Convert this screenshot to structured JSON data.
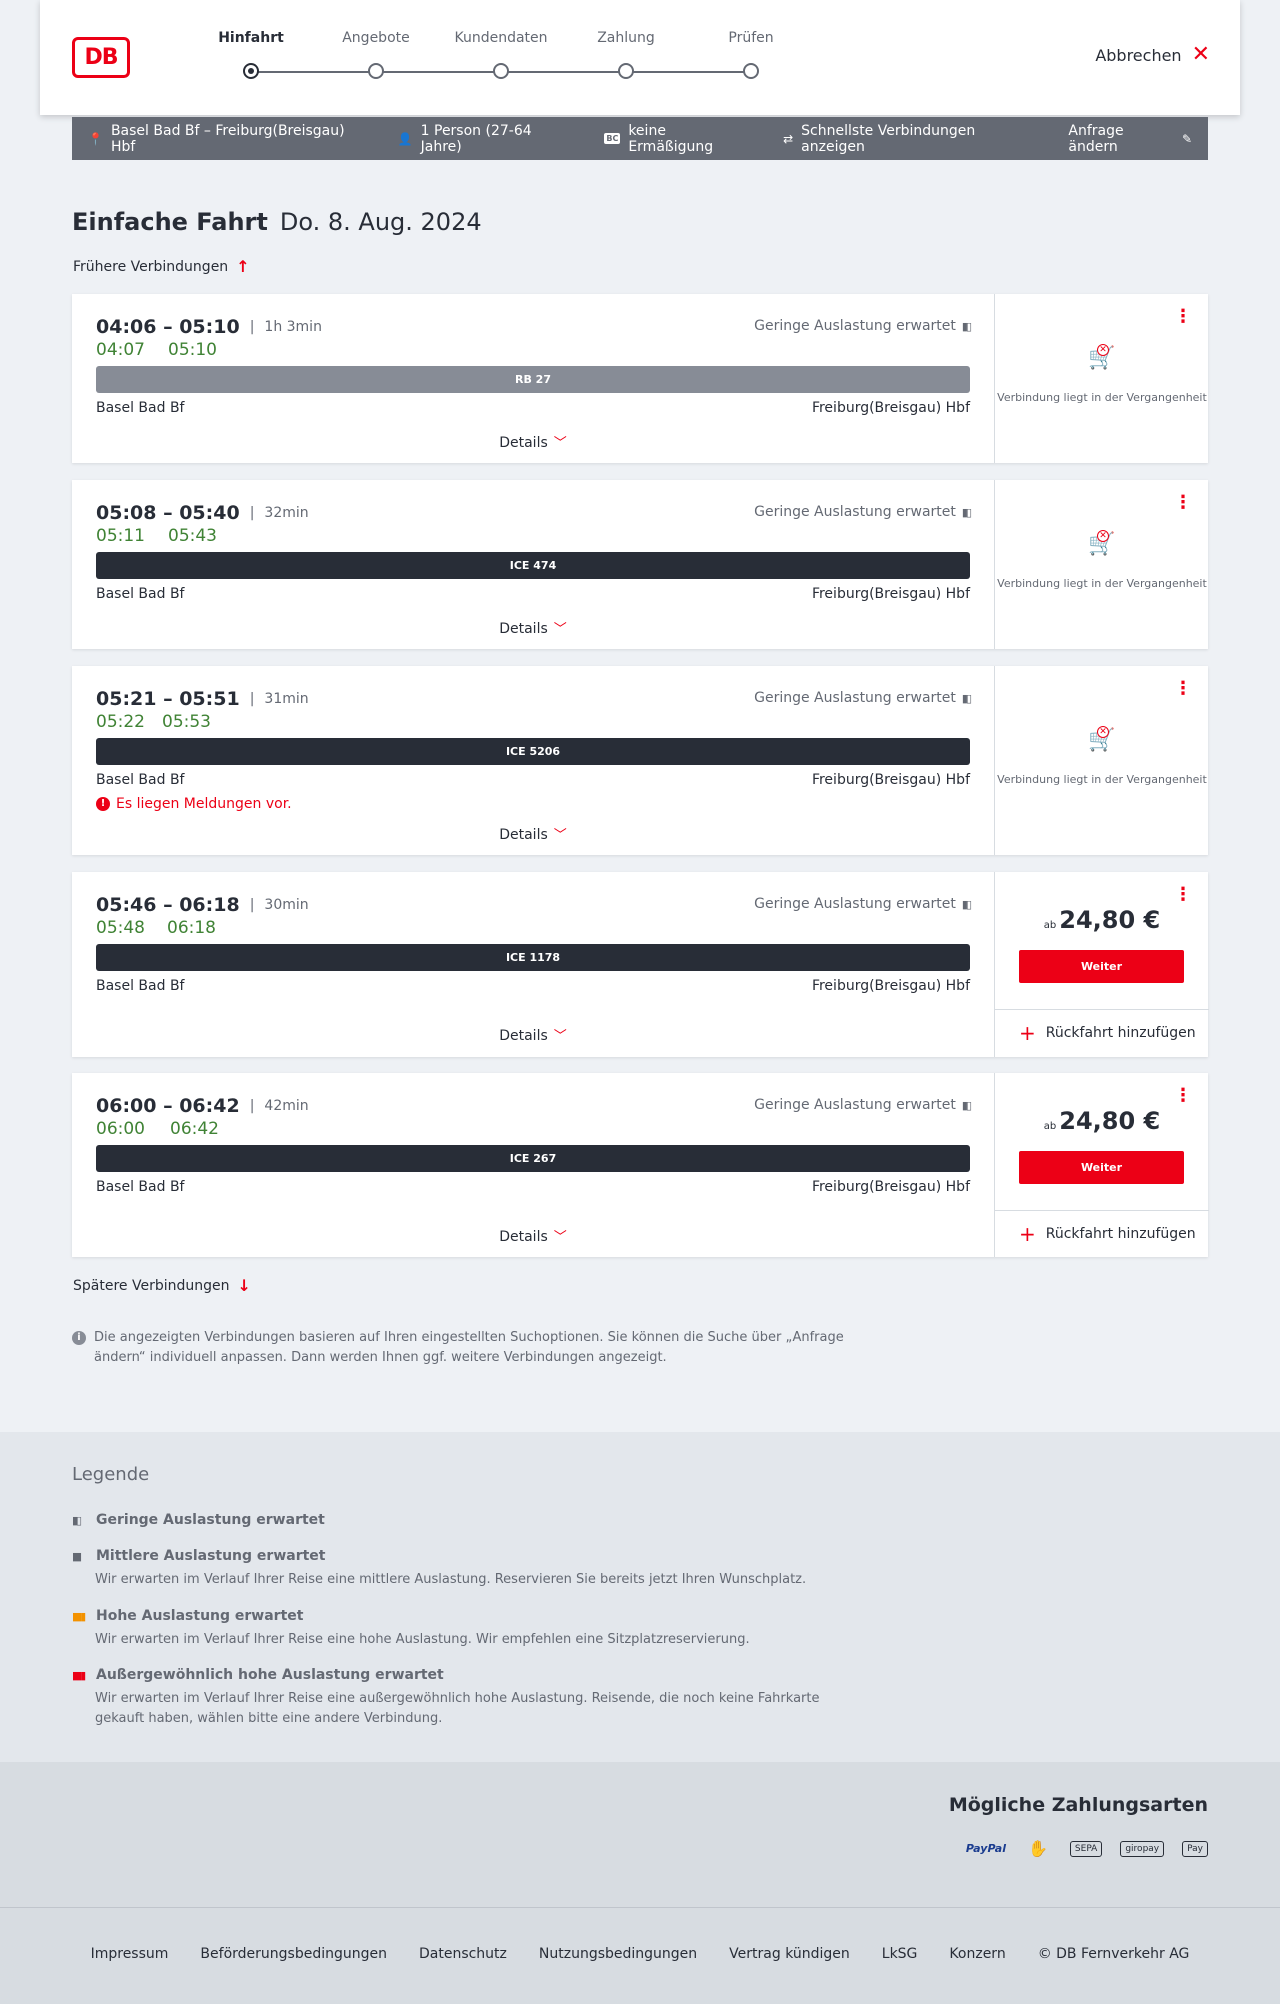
{
  "header": {
    "logo": "DB",
    "steps": [
      "Hinfahrt",
      "Angebote",
      "Kundendaten",
      "Zahlung",
      "Prüfen"
    ],
    "cancel_label": "Abbrechen"
  },
  "summary": {
    "route": "Basel Bad Bf – Freiburg(Breisgau) Hbf",
    "travellers": "1 Person (27-64 Jahre)",
    "bc_badge": "BC",
    "discount": "keine Ermäßigung",
    "fastest": "Schnellste Verbindungen anzeigen",
    "change": "Anfrage ändern"
  },
  "page": {
    "trip_type": "Einfache Fahrt",
    "date": "Do. 8. Aug. 2024",
    "earlier": "Frühere Verbindungen",
    "later": "Spätere Verbindungen",
    "details_label": "Details",
    "past_text": "Verbindung liegt in der Vergangenheit",
    "price_prefix": "ab",
    "continue_label": "Weiter",
    "return_label": "Rückfahrt hinzufügen",
    "info_text": "Die angezeigten Verbindungen basieren auf Ihren eingestellten Suchoptionen. Sie können die Suche über „Anfrage ändern“ individuell anpassen. Dann werden Ihnen ggf. weitere Verbindungen angezeigt."
  },
  "connections": [
    {
      "plan": "04:06 – 05:10",
      "duration": "1h 3min",
      "rt_dep": "04:07",
      "rt_arr": "05:10",
      "load": "Geringe Auslastung erwartet",
      "train": "RB 27",
      "from": "Basel Bad Bf",
      "to": "Freiburg(Breisgau) Hbf",
      "message": "",
      "price": "",
      "past": true
    },
    {
      "plan": "05:08 – 05:40",
      "duration": "32min",
      "rt_dep": "05:11",
      "rt_arr": "05:43",
      "load": "Geringe Auslastung erwartet",
      "train": "ICE 474",
      "from": "Basel Bad Bf",
      "to": "Freiburg(Breisgau) Hbf",
      "message": "",
      "price": "",
      "past": true
    },
    {
      "plan": "05:21 – 05:51",
      "duration": "31min",
      "rt_dep": "05:22",
      "rt_arr": "05:53",
      "load": "Geringe Auslastung erwartet",
      "train": "ICE 5206",
      "from": "Basel Bad Bf",
      "to": "Freiburg(Breisgau) Hbf",
      "message": "Es liegen Meldungen vor.",
      "price": "",
      "past": true
    },
    {
      "plan": "05:46 – 06:18",
      "duration": "30min",
      "rt_dep": "05:48",
      "rt_arr": "06:18",
      "load": "Geringe Auslastung erwartet",
      "train": "ICE 1178",
      "from": "Basel Bad Bf",
      "to": "Freiburg(Breisgau) Hbf",
      "message": "",
      "price": "24,80 €",
      "past": false
    },
    {
      "plan": "06:00 – 06:42",
      "duration": "42min",
      "rt_dep": "06:00",
      "rt_arr": "06:42",
      "load": "Geringe Auslastung erwartet",
      "train": "ICE 267",
      "from": "Basel Bad Bf",
      "to": "Freiburg(Breisgau) Hbf",
      "message": "",
      "price": "24,80 €",
      "past": false
    }
  ],
  "legend": {
    "title": "Legende",
    "items": [
      {
        "title": "Geringe Auslastung erwartet",
        "text": ""
      },
      {
        "title": "Mittlere Auslastung erwartet",
        "text": "Wir erwarten im Verlauf Ihrer Reise eine mittlere Auslastung. Reservieren Sie bereits jetzt Ihren Wunschplatz."
      },
      {
        "title": "Hohe Auslastung erwartet",
        "text": "Wir erwarten im Verlauf Ihrer Reise eine hohe Auslastung. Wir empfehlen eine Sitzplatzreservierung."
      },
      {
        "title": "Außergewöhnlich hohe Auslastung erwartet",
        "text": "Wir erwarten im Verlauf Ihrer Reise eine außergewöhnlich hohe Auslastung. Reisende, die noch keine Fahrkarte gekauft haben, wählen bitte eine andere Verbindung."
      }
    ]
  },
  "payment": {
    "title": "Mögliche Zahlungsarten",
    "paypal": "PayPal",
    "sepa": "SEPA",
    "giropay": "giropay",
    "applepay": "Pay"
  },
  "footer": {
    "links": [
      "Impressum",
      "Beförderungsbedingungen",
      "Datenschutz",
      "Nutzungsbedingungen",
      "Vertrag kündigen",
      "LkSG",
      "Konzern",
      "© DB Fernverkehr AG"
    ]
  },
  "colors": {
    "brand_red": "#ec0016",
    "realtime_green": "#408335",
    "dark": "#282d37",
    "regio_gray": "#878c96"
  },
  "icons": [
    "location-pin-icon",
    "person-icon",
    "swap-icon",
    "pencil-icon",
    "close-icon",
    "arrow-up-icon",
    "arrow-down-icon",
    "chevron-down-icon",
    "kebab-menu-icon",
    "cart-unavailable-icon",
    "warning-icon",
    "info-icon",
    "plus-icon"
  ]
}
